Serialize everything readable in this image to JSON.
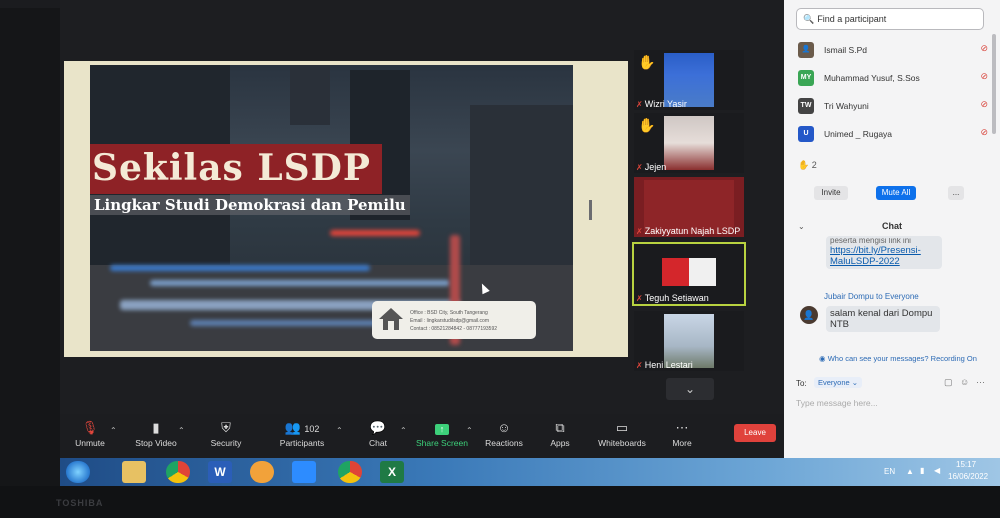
{
  "slide": {
    "title": "Sekilas LSDP",
    "subtitle": "Lingkar Studi Demokrasi dan Pemilu",
    "office_lines": [
      "Office : BSD City, South Tangerang",
      "Email : lingkarstudilsdp@gmail.com",
      "Contact : 08521284842 - 08777193592"
    ]
  },
  "gallery": [
    {
      "name": "Wizri Yasir",
      "hand": true
    },
    {
      "name": "Jejen",
      "hand": true
    },
    {
      "name": "Zakiyyatun Najah LSDP",
      "hand": false
    },
    {
      "name": "Teguh Setiawan",
      "hand": false,
      "active": true
    },
    {
      "name": "Heni Lestari",
      "hand": false
    }
  ],
  "gallery_more_icon": "chevron-down-icon",
  "toolbar": {
    "unmute": "Unmute",
    "stop_video": "Stop Video",
    "security": "Security",
    "participants": "Participants",
    "participants_count": "102",
    "chat": "Chat",
    "share_screen": "Share Screen",
    "reactions": "Reactions",
    "apps": "Apps",
    "whiteboards": "Whiteboards",
    "more": "More",
    "leave": "Leave"
  },
  "panel": {
    "search_placeholder": "Find a participant",
    "participants": [
      {
        "initials": "",
        "name": "Ismail S.Pd",
        "color": "#6b5b4b"
      },
      {
        "initials": "MY",
        "name": "Muhammad Yusuf, S.Sos",
        "color": "#3aa655"
      },
      {
        "initials": "TW",
        "name": "Tri Wahyuni",
        "color": "#444444"
      },
      {
        "initials": "U",
        "name": "Unimed _ Rugaya",
        "color": "#2458c8"
      }
    ],
    "raised_hands": "2",
    "invite": "Invite",
    "mute_all": "Mute All",
    "more": "...",
    "chat_title": "Chat",
    "msg1_partial": "peserta mengisi link ini",
    "msg1_link": "https://bit.ly/Presensi-MaluLSDP-2022",
    "sender2": "Jubair Dompu to Everyone",
    "msg2": "salam kenal dari Dompu NTB",
    "who_can_see": "Who can see your messages? Recording On",
    "to_label": "To:",
    "to_value": "Everyone",
    "type_placeholder": "Type message here..."
  },
  "taskbar": {
    "lang": "EN",
    "time": "15:17",
    "date": "16/06/2022"
  },
  "bezel_brand": "TOSHIBA",
  "colors": {
    "accent_green": "#3dd07a",
    "leave_red": "#e0423c",
    "mute_all_blue": "#0e71eb",
    "active_border": "#b8d240"
  }
}
